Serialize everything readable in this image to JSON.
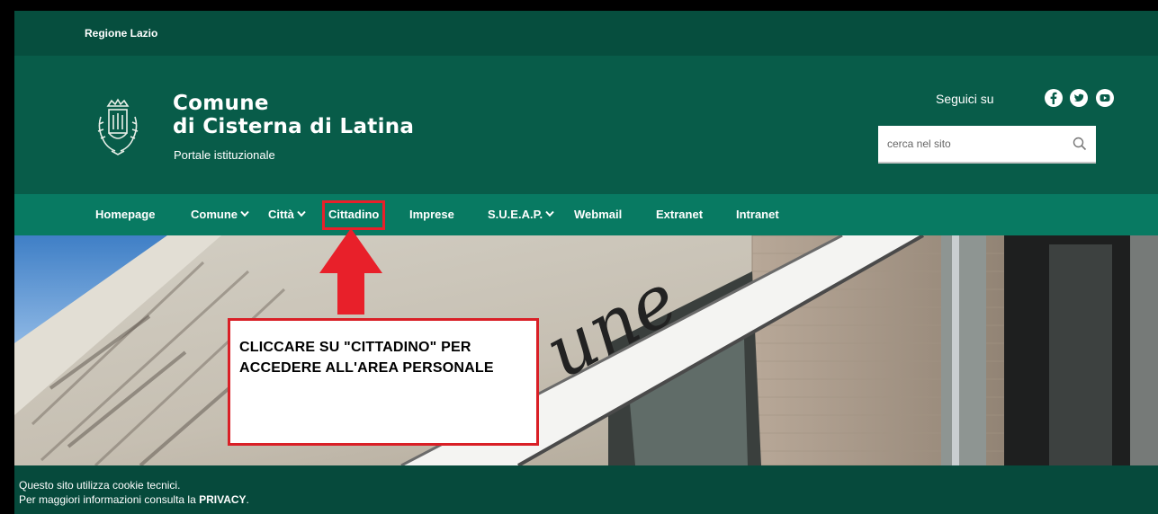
{
  "region_bar": {
    "link": "Regione Lazio"
  },
  "header": {
    "title_line1": "Comune",
    "title_line2": "di Cisterna di Latina",
    "subtitle": "Portale istituzionale",
    "follow_label": "Seguici su",
    "social": [
      "facebook-icon",
      "twitter-icon",
      "youtube-icon"
    ],
    "search": {
      "placeholder": "cerca nel sito",
      "value": ""
    }
  },
  "nav": {
    "items": [
      {
        "label": "Homepage",
        "dropdown": false
      },
      {
        "label": "Comune",
        "dropdown": true
      },
      {
        "label": "Città",
        "dropdown": true
      },
      {
        "label": "Cittadino",
        "dropdown": false,
        "highlighted": true
      },
      {
        "label": "Imprese",
        "dropdown": false
      },
      {
        "label": "S.U.E.A.P.",
        "dropdown": true
      },
      {
        "label": "Webmail",
        "dropdown": false
      },
      {
        "label": "Extranet",
        "dropdown": false
      },
      {
        "label": "Intranet",
        "dropdown": false
      }
    ]
  },
  "hero": {
    "sign_text": "une"
  },
  "annotation": {
    "line1": "CLICCARE SU \"CITTADINO\" PER",
    "line2": "ACCEDERE ALL'AREA PERSONALE"
  },
  "cookie": {
    "line1": "Questo sito utilizza cookie tecnici.",
    "line2_prefix": "Per maggiori informazioni consulta la ",
    "line2_link": "PRIVACY",
    "line2_suffix": "."
  },
  "colors": {
    "region_bar": "#064e3e",
    "header": "#085c49",
    "nav": "#087a62",
    "highlight": "#e8202a",
    "cookie_bar": "#064a3c"
  }
}
